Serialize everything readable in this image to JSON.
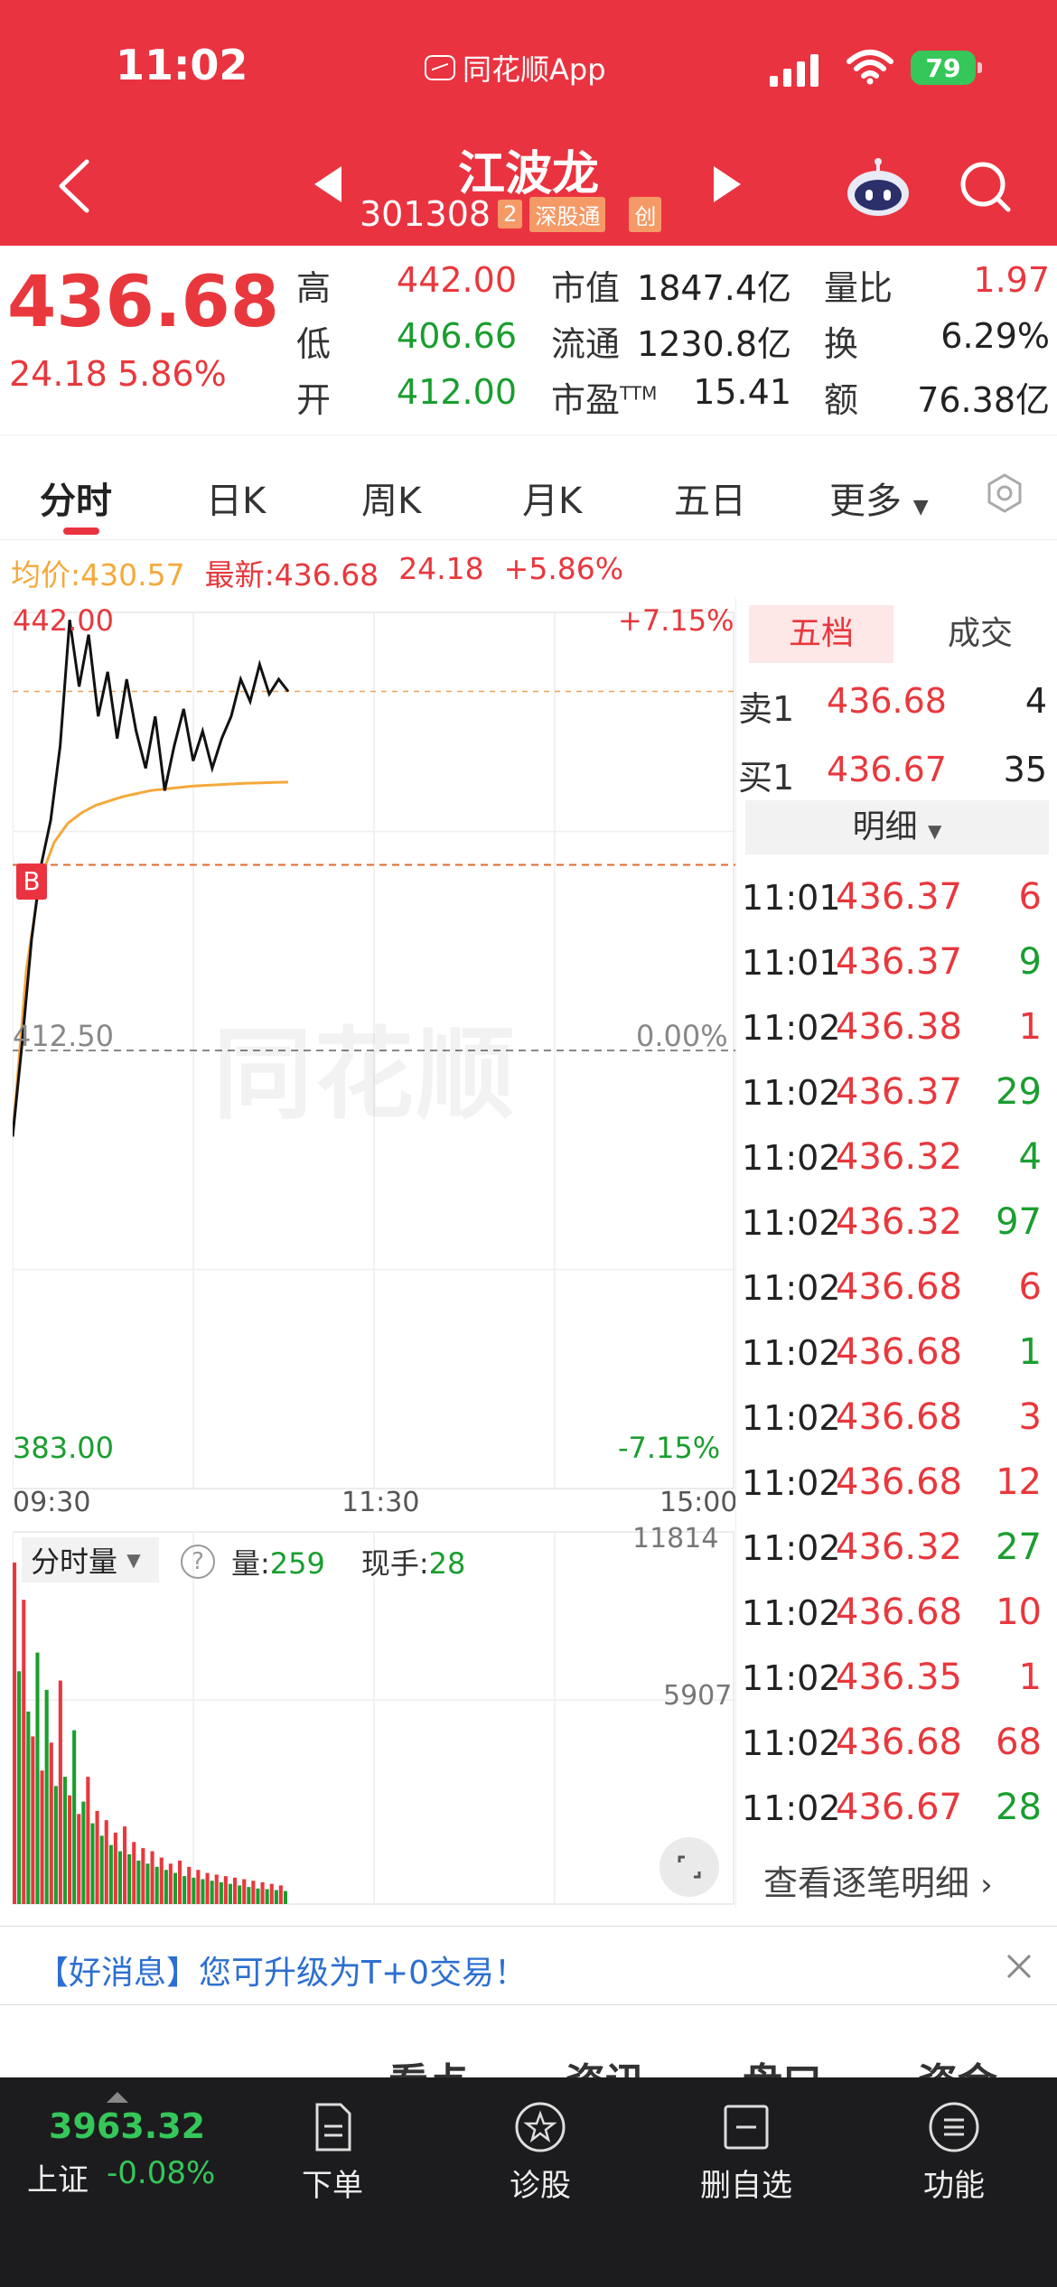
{
  "status": {
    "time": "11:02",
    "app_label": "同花顺App",
    "battery": "79"
  },
  "header": {
    "stock_name": "江波龙",
    "code": "301308",
    "tag_num": "2",
    "tag_connect": "深股通",
    "tag_board": "创"
  },
  "quote": {
    "price": "436.68",
    "change": "24.18",
    "change_pct": "5.86%",
    "high_label": "高",
    "high": "442.00",
    "low_label": "低",
    "low": "406.66",
    "open_label": "开",
    "open": "412.00",
    "mcap_label": "市值",
    "mcap": "1847.4亿",
    "float_label": "流通",
    "float": "1230.8亿",
    "pe_label": "市盈",
    "pe_suffix": "TTM",
    "pe": "15.41",
    "volratio_label": "量比",
    "volratio": "1.97",
    "turnover_label": "换",
    "turnover": "6.29%",
    "amount_label": "额",
    "amount": "76.38亿"
  },
  "tabs": [
    "分时",
    "日K",
    "周K",
    "月K",
    "五日",
    "更多"
  ],
  "info": {
    "avg": "均价:430.57",
    "latest": "最新:436.68",
    "change": "24.18",
    "pct": "+5.86%"
  },
  "chart": {
    "y_top": "442.00",
    "y_mid": "412.50",
    "y_bottom": "383.00",
    "pct_top": "+7.15%",
    "pct_mid": "0.00%",
    "pct_bottom": "-7.15%",
    "x_start": "09:30",
    "x_mid": "11:30",
    "x_end": "15:00",
    "marker": "B",
    "watermark": "同花顺"
  },
  "chart_data": {
    "type": "line",
    "ylim": [
      383.0,
      442.0
    ],
    "price_line": [
      406.7,
      413.0,
      420.0,
      425.0,
      428.0,
      433.0,
      441.5,
      437.0,
      440.5,
      435.0,
      438.0,
      433.5,
      437.5,
      434.0,
      431.5,
      435.0,
      430.0,
      433.0,
      435.5,
      432.0,
      434.0,
      431.5,
      433.5,
      435.0,
      437.5,
      436.0,
      438.5,
      436.5,
      437.5,
      436.68
    ],
    "avg_line": [
      406.7,
      418.0,
      424.0,
      426.5,
      427.8,
      428.5,
      429.0,
      429.3,
      429.6,
      429.8,
      430.0,
      430.1,
      430.2,
      430.3,
      430.35,
      430.4,
      430.45,
      430.5,
      430.52,
      430.55,
      430.57
    ],
    "volume": {
      "y_top": "11814",
      "y_mid": "5907",
      "label": "分时量",
      "vol_label": "量:",
      "vol": "259",
      "hand_label": "现手:",
      "hand": "28",
      "bars": [
        11000,
        7500,
        9800,
        6200,
        5400,
        8100,
        4300,
        6900,
        5200,
        3800,
        7200,
        4100,
        3500,
        5600,
        2900,
        3300,
        4100,
        2600,
        3000,
        2200,
        2700,
        1900,
        2300,
        1700,
        2500,
        1600,
        2000,
        1400,
        1800,
        1300,
        1700,
        1200,
        1500,
        1100,
        1300,
        1000,
        1400,
        900,
        1200,
        850,
        1100,
        800,
        1000,
        750,
        950,
        700,
        900,
        650,
        850,
        600,
        800,
        550,
        750,
        500,
        700,
        480,
        650,
        450,
        600,
        420
      ]
    }
  },
  "panel": {
    "tab_five": "五档",
    "tab_trades": "成交",
    "sell_label": "卖1",
    "sell_price": "436.68",
    "sell_vol": "4",
    "buy_label": "买1",
    "buy_price": "436.67",
    "buy_vol": "35",
    "detail_label": "明细",
    "trades": [
      {
        "time": "11:01",
        "price": "436.37",
        "vol": "6",
        "dir": "red"
      },
      {
        "time": "11:01",
        "price": "436.37",
        "vol": "9",
        "dir": "green"
      },
      {
        "time": "11:02",
        "price": "436.38",
        "vol": "1",
        "dir": "red"
      },
      {
        "time": "11:02",
        "price": "436.37",
        "vol": "29",
        "dir": "green"
      },
      {
        "time": "11:02",
        "price": "436.32",
        "vol": "4",
        "dir": "green"
      },
      {
        "time": "11:02",
        "price": "436.32",
        "vol": "97",
        "dir": "green"
      },
      {
        "time": "11:02",
        "price": "436.68",
        "vol": "6",
        "dir": "red"
      },
      {
        "time": "11:02",
        "price": "436.68",
        "vol": "1",
        "dir": "green"
      },
      {
        "time": "11:02",
        "price": "436.68",
        "vol": "3",
        "dir": "red"
      },
      {
        "time": "11:02",
        "price": "436.68",
        "vol": "12",
        "dir": "red"
      },
      {
        "time": "11:02",
        "price": "436.32",
        "vol": "27",
        "dir": "green"
      },
      {
        "time": "11:02",
        "price": "436.68",
        "vol": "10",
        "dir": "red"
      },
      {
        "time": "11:02",
        "price": "436.35",
        "vol": "1",
        "dir": "red"
      },
      {
        "time": "11:02",
        "price": "436.68",
        "vol": "68",
        "dir": "red"
      },
      {
        "time": "11:02",
        "price": "436.67",
        "vol": "28",
        "dir": "green"
      }
    ],
    "view_all": "查看逐笔明细"
  },
  "news": {
    "text": "【好消息】您可升级为T+0交易！"
  },
  "peek": [
    "看点",
    "资讯",
    "盘口",
    "资金"
  ],
  "bottom": {
    "index_value": "3963.32",
    "index_name": "上证",
    "index_pct": "-0.08%",
    "nav": [
      "下单",
      "诊股",
      "删自选",
      "功能"
    ]
  },
  "colors": {
    "brand_red": "#ea3340",
    "up_red": "#e8383d",
    "down_green": "#1a9e2f",
    "avg_line": "#f4a93b"
  }
}
